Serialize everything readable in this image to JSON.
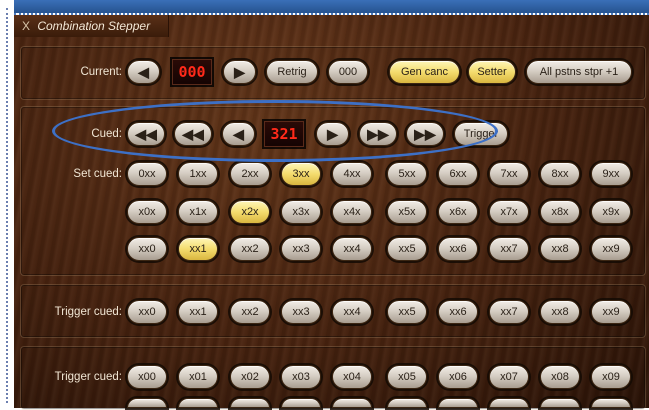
{
  "window": {
    "title": "Combination Stepper",
    "close_glyph": "X"
  },
  "current": {
    "label": "Current:",
    "display": "000",
    "retrig": "Retrig",
    "value_btn": "000",
    "gen_canc": "Gen canc",
    "setter": "Setter",
    "all_pstns": "All pstns stpr +1"
  },
  "cued": {
    "label": "Cued:",
    "display": "321",
    "trigger": "Trigger",
    "arrows": {
      "first": "◀◀",
      "prev_fast": "◀◀",
      "prev": "◀",
      "next": "▶",
      "next_fast": "▶▶",
      "last": "▶▶"
    }
  },
  "set_cued": {
    "label": "Set cued:",
    "rows": [
      [
        "0xx",
        "1xx",
        "2xx",
        "3xx",
        "4xx",
        "5xx",
        "6xx",
        "7xx",
        "8xx",
        "9xx"
      ],
      [
        "x0x",
        "x1x",
        "x2x",
        "x3x",
        "x4x",
        "x5x",
        "x6x",
        "x7x",
        "x8x",
        "x9x"
      ],
      [
        "xx0",
        "xx1",
        "xx2",
        "xx3",
        "xx4",
        "xx5",
        "xx6",
        "xx7",
        "xx8",
        "xx9"
      ]
    ],
    "active": [
      "3xx",
      "x2x",
      "xx1"
    ]
  },
  "trigger_cued_1": {
    "label": "Trigger cued:",
    "buttons": [
      "xx0",
      "xx1",
      "xx2",
      "xx3",
      "xx4",
      "xx5",
      "xx6",
      "xx7",
      "xx8",
      "xx9"
    ]
  },
  "trigger_cued_2": {
    "label": "Trigger cued:",
    "buttons": [
      "x00",
      "x01",
      "x02",
      "x03",
      "x04",
      "x05",
      "x06",
      "x07",
      "x08",
      "x09"
    ]
  },
  "colors": {
    "active": "#f4dc6e",
    "display_text": "#ff2a1a",
    "highlight_oval": "#3d70c6"
  }
}
